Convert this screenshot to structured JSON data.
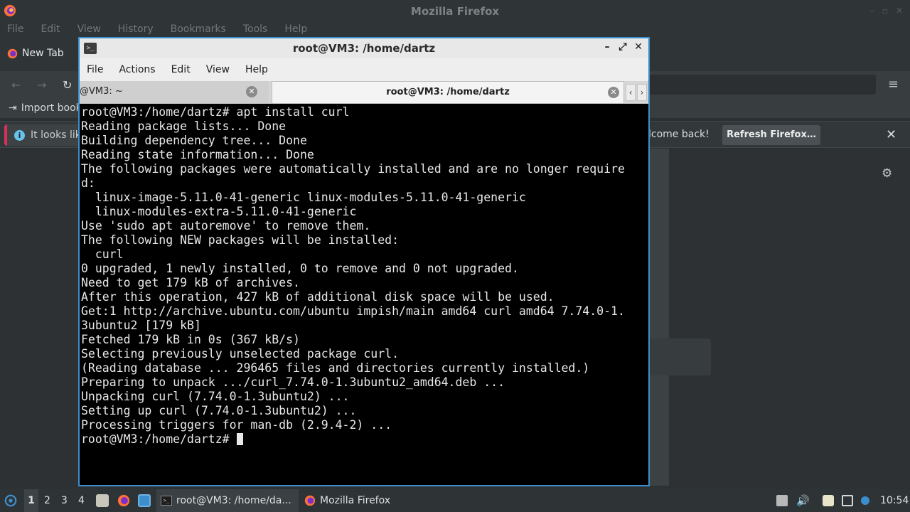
{
  "firefox": {
    "title": "Mozilla Firefox",
    "window_controls": [
      "–",
      "▫",
      "✕"
    ],
    "menu": [
      "File",
      "Edit",
      "View",
      "History",
      "Bookmarks",
      "Tools",
      "Help"
    ],
    "tab_label": "New Tab",
    "import_bookmarks": "Import book",
    "info_left": "It looks lik",
    "info_right": "lcome back!",
    "refresh_button": "Refresh Firefox…",
    "menu_icon": "hamburger-icon"
  },
  "terminal": {
    "title": "root@VM3: /home/dartz",
    "menu": [
      "File",
      "Actions",
      "Edit",
      "View",
      "Help"
    ],
    "tabs": [
      {
        "label": "@VM3: ~"
      },
      {
        "label": "root@VM3: /home/dartz"
      }
    ],
    "lines": [
      "root@VM3:/home/dartz# apt install curl",
      "Reading package lists... Done",
      "Building dependency tree... Done",
      "Reading state information... Done",
      "The following packages were automatically installed and are no longer require",
      "d:",
      "  linux-image-5.11.0-41-generic linux-modules-5.11.0-41-generic",
      "  linux-modules-extra-5.11.0-41-generic",
      "Use 'sudo apt autoremove' to remove them.",
      "The following NEW packages will be installed:",
      "  curl",
      "0 upgraded, 1 newly installed, 0 to remove and 0 not upgraded.",
      "Need to get 179 kB of archives.",
      "After this operation, 427 kB of additional disk space will be used.",
      "Get:1 http://archive.ubuntu.com/ubuntu impish/main amd64 curl amd64 7.74.0-1.",
      "3ubuntu2 [179 kB]",
      "Fetched 179 kB in 0s (367 kB/s)",
      "Selecting previously unselected package curl.",
      "(Reading database ... 296465 files and directories currently installed.)",
      "Preparing to unpack .../curl_7.74.0-1.3ubuntu2_amd64.deb ...",
      "Unpacking curl (7.74.0-1.3ubuntu2) ...",
      "Setting up curl (7.74.0-1.3ubuntu2) ...",
      "Processing triggers for man-db (2.9.4-2) ..."
    ],
    "prompt": "root@VM3:/home/dartz# "
  },
  "panel": {
    "workspaces": [
      "1",
      "2",
      "3",
      "4"
    ],
    "tasks": [
      {
        "label": "root@VM3: /home/da..."
      },
      {
        "label": "Mozilla Firefox"
      }
    ],
    "clock": "10:54"
  },
  "colors": {
    "accent": "#3d8ecc",
    "firefox_orange": "#ff7139",
    "firefox_purple": "#7b2fc9"
  }
}
